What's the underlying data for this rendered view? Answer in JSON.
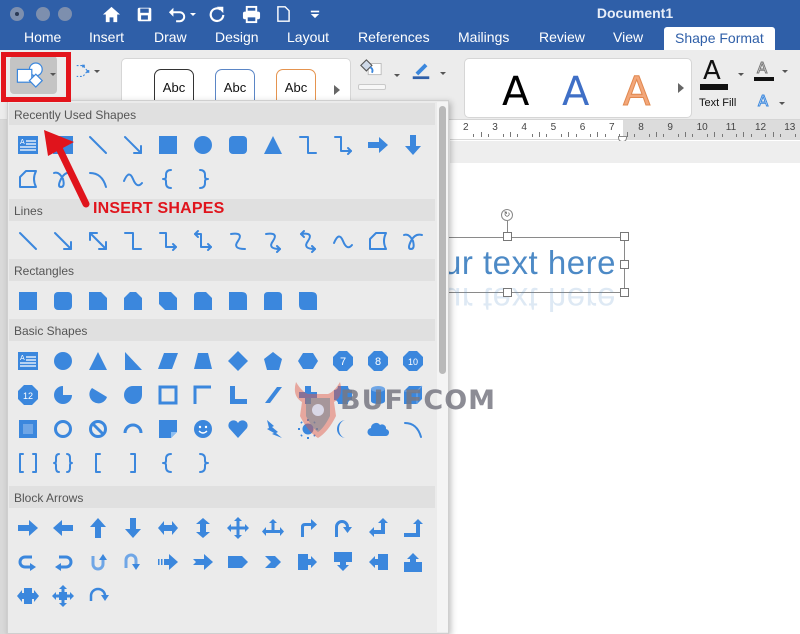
{
  "window": {
    "title": "Document1",
    "traffic_lights": [
      "close",
      "minimize",
      "zoom"
    ],
    "quick_access": [
      {
        "name": "home-icon",
        "label": "Home"
      },
      {
        "name": "save-icon",
        "label": "Save"
      },
      {
        "name": "undo-icon",
        "label": "Undo"
      },
      {
        "name": "redo-icon",
        "label": "Redo"
      },
      {
        "name": "print-icon",
        "label": "Print"
      },
      {
        "name": "new-document-icon",
        "label": "New"
      },
      {
        "name": "customize-toolbar-icon",
        "label": "Customize"
      }
    ]
  },
  "tabs": [
    {
      "label": "Home",
      "active": false
    },
    {
      "label": "Insert",
      "active": false
    },
    {
      "label": "Draw",
      "active": false
    },
    {
      "label": "Design",
      "active": false
    },
    {
      "label": "Layout",
      "active": false
    },
    {
      "label": "References",
      "active": false
    },
    {
      "label": "Mailings",
      "active": false
    },
    {
      "label": "Review",
      "active": false
    },
    {
      "label": "View",
      "active": false
    },
    {
      "label": "Shape Format",
      "active": true
    }
  ],
  "ribbon": {
    "insert_shapes_label": "Insert Shapes",
    "shape_styles": [
      "Abc",
      "Abc",
      "Abc"
    ],
    "shape_style_colors": [
      "#333333",
      "#5b86c6",
      "#e5944f"
    ],
    "wordart_styles": [
      "A",
      "A",
      "A"
    ],
    "wordart_colors": [
      "#000000",
      "#3f6fc6",
      "#f3a77a"
    ],
    "text_fill_label": "Text Fill"
  },
  "ruler": {
    "numbers": [
      "2",
      "3",
      "4",
      "5",
      "6",
      "7",
      "8",
      "9",
      "10",
      "11",
      "12",
      "13"
    ]
  },
  "document": {
    "textbox_text": "ur text here"
  },
  "colors": {
    "accent": "#2f5fa8",
    "shape_blue": "#3b87dd",
    "annotation_red": "#e3141b"
  },
  "shapes_panel": {
    "sections": [
      {
        "title": "Recently Used Shapes",
        "shapes": [
          "text-box",
          "vertical-text-box",
          "line",
          "line-arrow",
          "rectangle",
          "oval",
          "rounded-rectangle",
          "triangle",
          "elbow-connector",
          "elbow-arrow-connector",
          "right-arrow",
          "down-arrow",
          "freeform-shape",
          "scribble",
          "arc",
          "curve",
          "left-brace",
          "right-brace"
        ]
      },
      {
        "title": "Lines",
        "shapes": [
          "line",
          "line-arrow",
          "line-double-arrow",
          "elbow-connector",
          "elbow-arrow-connector",
          "elbow-double-arrow-connector",
          "curved-connector",
          "curved-arrow-connector",
          "curved-double-arrow-connector",
          "curve",
          "freeform-shape",
          "scribble"
        ]
      },
      {
        "title": "Rectangles",
        "shapes": [
          "rectangle",
          "rounded-rectangle",
          "snip-single-corner",
          "snip-same-side",
          "snip-diagonal",
          "snip-round-single",
          "round-single-corner",
          "round-same-side",
          "round-diagonal"
        ]
      },
      {
        "title": "Basic Shapes",
        "shapes": [
          "text-box",
          "oval",
          "isosceles-triangle",
          "right-triangle",
          "parallelogram",
          "trapezoid",
          "diamond",
          "pentagon",
          "hexagon",
          "heptagon",
          "octagon",
          "decagon",
          "dodecagon",
          "pie",
          "chord",
          "teardrop",
          "frame",
          "half-frame",
          "l-shape",
          "diagonal-stripe",
          "cross",
          "plaque",
          "can",
          "cube",
          "bevel",
          "donut",
          "no-symbol",
          "block-arc",
          "folded-corner",
          "smiley-face",
          "heart",
          "lightning-bolt",
          "sun",
          "moon",
          "cloud",
          "arc",
          "double-bracket",
          "double-brace",
          "left-bracket",
          "right-bracket",
          "left-brace",
          "right-brace"
        ],
        "badges": {
          "heptagon": "7",
          "octagon": "8",
          "decagon": "10",
          "dodecagon": "12"
        }
      },
      {
        "title": "Block Arrows",
        "shapes": [
          "right-arrow",
          "left-arrow",
          "up-arrow",
          "down-arrow",
          "left-right-arrow",
          "up-down-arrow",
          "quad-arrow",
          "left-right-up-arrow",
          "bent-arrow",
          "u-turn-arrow",
          "left-up-arrow",
          "bent-up-arrow",
          "curved-right-arrow",
          "curved-left-arrow",
          "curved-up-arrow",
          "curved-down-arrow",
          "striped-right-arrow",
          "notched-right-arrow",
          "pentagon-arrow",
          "chevron",
          "right-arrow-callout",
          "down-arrow-callout",
          "left-arrow-callout",
          "up-arrow-callout",
          "left-right-arrow-callout",
          "quad-arrow-callout",
          "circular-arrow"
        ]
      }
    ]
  },
  "annotation": {
    "text": "INSERT SHAPES"
  },
  "watermark": {
    "text": "BUFFCOM"
  }
}
